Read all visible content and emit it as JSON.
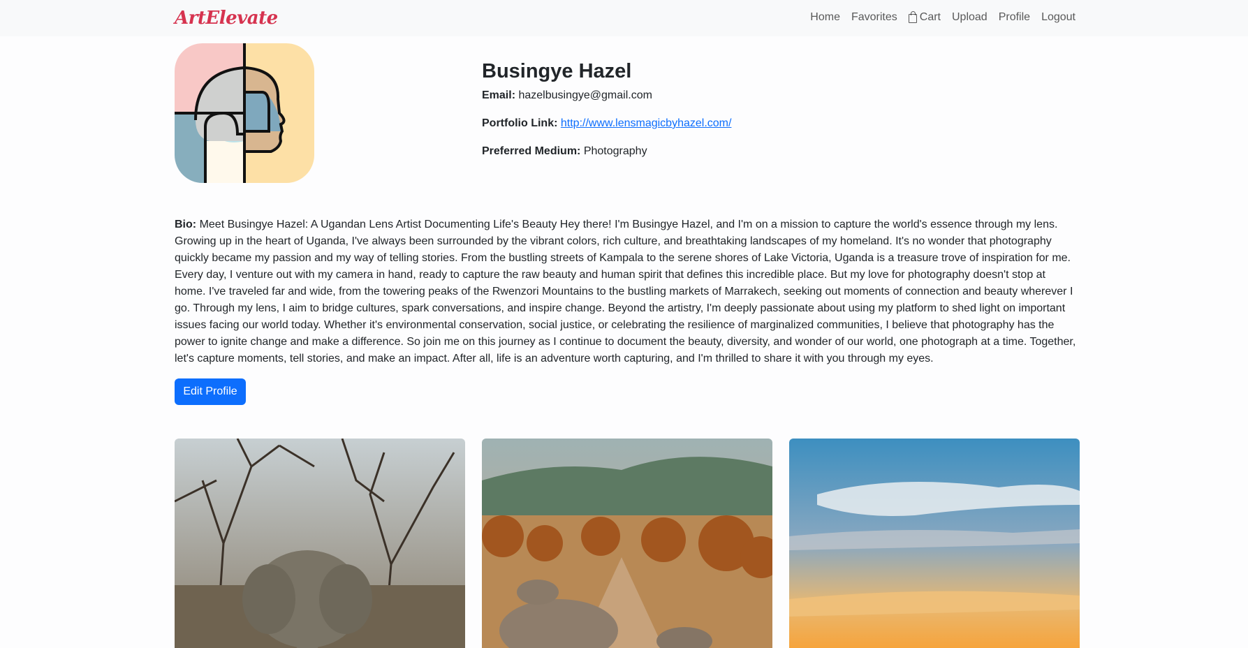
{
  "brand": "ArtElevate",
  "nav": {
    "home": "Home",
    "favorites": "Favorites",
    "cart": "Cart",
    "upload": "Upload",
    "profile": "Profile",
    "logout": "Logout"
  },
  "profile": {
    "name": "Busingye Hazel",
    "email_label": "Email:",
    "email": "hazelbusingye@gmail.com",
    "portfolio_label": "Portfolio Link:",
    "portfolio": "http://www.lensmagicbyhazel.com/",
    "medium_label": "Preferred Medium:",
    "medium": "Photography",
    "bio_label": "Bio:",
    "bio": "Meet Busingye Hazel: A Ugandan Lens Artist Documenting Life's Beauty Hey there! I'm Busingye Hazel, and I'm on a mission to capture the world's essence through my lens. Growing up in the heart of Uganda, I've always been surrounded by the vibrant colors, rich culture, and breathtaking landscapes of my homeland. It's no wonder that photography quickly became my passion and my way of telling stories. From the bustling streets of Kampala to the serene shores of Lake Victoria, Uganda is a treasure trove of inspiration for me. Every day, I venture out with my camera in hand, ready to capture the raw beauty and human spirit that defines this incredible place. But my love for photography doesn't stop at home. I've traveled far and wide, from the towering peaks of the Rwenzori Mountains to the bustling markets of Marrakech, seeking out moments of connection and beauty wherever I go. Through my lens, I aim to bridge cultures, spark conversations, and inspire change. Beyond the artistry, I'm deeply passionate about using my platform to shed light on important issues facing our world today. Whether it's environmental conservation, social justice, or celebrating the resilience of marginalized communities, I believe that photography has the power to ignite change and make a difference. So join me on this journey as I continue to document the beauty, diversity, and wonder of our world, one photograph at a time. Together, let's capture moments, tell stories, and make an impact. After all, life is an adventure worth capturing, and I'm thrilled to share it with you through my eyes.",
    "edit_button": "Edit Profile"
  },
  "colors": {
    "brand": "#d6334f",
    "primary": "#0d6efd",
    "navbar_bg": "#f8f9fa"
  },
  "gallery": [
    {
      "icon": "elephant-photo"
    },
    {
      "icon": "rhino-savanna-photo"
    },
    {
      "icon": "sunset-sky-photo"
    }
  ]
}
